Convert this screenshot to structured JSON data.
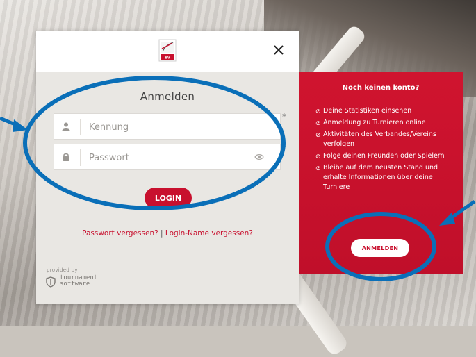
{
  "login": {
    "title": "Anmelden",
    "username_placeholder": "Kennung",
    "password_placeholder": "Passwort",
    "required_mark": "*",
    "login_button": "LOGIN",
    "forgot_password": "Passwort vergessen?",
    "link_separator": " | ",
    "forgot_username": "Login-Name vergessen?",
    "close_icon": "close-icon",
    "provided_by": "provided by",
    "footer_logo_line1": "tournament",
    "footer_logo_line2": "software"
  },
  "register_panel": {
    "title": "Noch keinen konto?",
    "benefits": [
      "Deine Statistiken einsehen",
      "Anmeldung zu Turnieren online",
      "Aktivitäten des Verbandes/Vereins verfolgen",
      "Folge deinen Freunden oder Spielern",
      "Bleibe auf dem neusten Stand und erhalte Informationen über deine Turniere"
    ],
    "register_button": "ANMELDEN"
  },
  "colors": {
    "brand_red": "#c8102e",
    "annotation_blue": "#0a6fb8"
  }
}
